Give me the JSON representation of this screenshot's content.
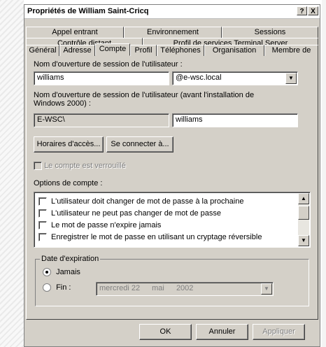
{
  "window": {
    "title": "Propriétés de William Saint-Cricq",
    "help_btn": "?",
    "close_btn": "X"
  },
  "tabs": {
    "row1": [
      "Appel entrant",
      "Environnement",
      "Sessions"
    ],
    "row2": [
      "Contrôle distant",
      "Profil de services Terminal Server"
    ],
    "row3": [
      "Général",
      "Adresse",
      "Compte",
      "Profil",
      "Téléphones",
      "Organisation",
      "Membre de"
    ],
    "active": "Compte"
  },
  "account": {
    "logon_name_label": "Nom d'ouverture de session de l'utilisateur :",
    "logon_name_value": "williams",
    "domain_value": "@e-wsc.local",
    "pre2000_label": "Nom d'ouverture de session de l'utilisateur (avant l'installation de Windows 2000) :",
    "pre2000_domain": "E-WSC\\",
    "pre2000_name": "williams",
    "logon_hours_btn": "Horaires d'accès...",
    "logon_to_btn": "Se connecter à...",
    "locked_label": "Le compte est verrouillé",
    "options_label": "Options de compte :",
    "options": [
      "L'utilisateur doit changer de mot de passe à la prochaine",
      "L'utilisateur ne peut pas changer de mot de passe",
      "Le mot de passe n'expire jamais",
      "Enregistrer le mot de passe en utilisant un cryptage réversible"
    ]
  },
  "expiration": {
    "legend": "Date d'expiration",
    "never_label": "Jamais",
    "end_label": "Fin :",
    "selected": "Jamais",
    "date_day": "mercredi 22",
    "date_month": "mai",
    "date_year": "2002"
  },
  "buttons": {
    "ok": "OK",
    "cancel": "Annuler",
    "apply": "Appliquer"
  },
  "icons": {
    "dropdown": "chevron-down-icon",
    "scroll_up": "arrow-up-icon",
    "scroll_down": "arrow-down-icon"
  }
}
